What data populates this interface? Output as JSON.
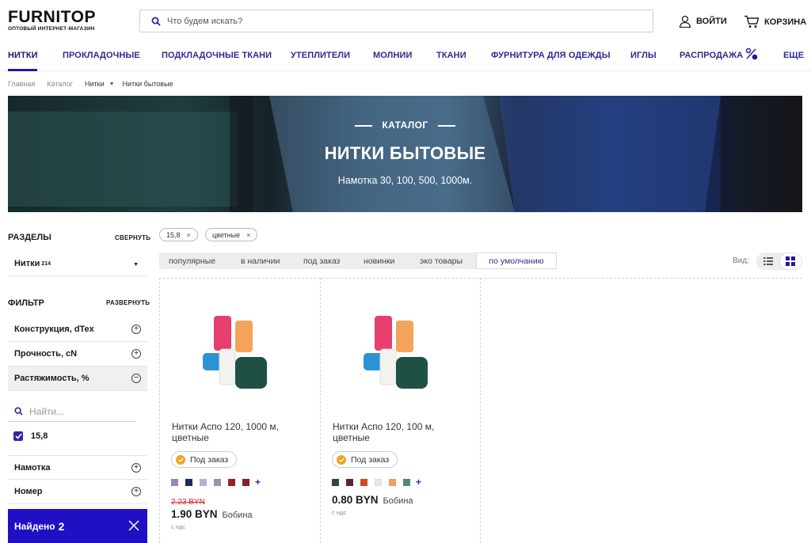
{
  "header": {
    "logo": "FURNITOP",
    "logo_sub": "ОПТОВЫЙ ИНТЕРНЕТ-МАГАЗИН",
    "search_placeholder": "Что будем искать?",
    "login": "ВОЙТИ",
    "cart": "КОРЗИНА"
  },
  "nav": {
    "items": [
      "НИТКИ",
      "ПРОКЛАДОЧНЫЕ",
      "ПОДКЛАДОЧНЫЕ ТКАНИ",
      "УТЕПЛИТЕЛИ",
      "МОЛНИИ",
      "ТКАНИ",
      "ФУРНИТУРА ДЛЯ ОДЕЖДЫ",
      "ИГЛЫ",
      "РАСПРОДАЖА",
      "ЕЩЕ"
    ],
    "active_index": 0,
    "accent": "#2217a6"
  },
  "breadcrumbs": [
    "Главная",
    "Каталог",
    "Нитки",
    "Нитки бытовые"
  ],
  "banner": {
    "kicker": "КАТАЛОГ",
    "title": "НИТКИ БЫТОВЫЕ",
    "subtitle": "Намотка 30, 100, 500, 1000м."
  },
  "sidebar": {
    "sections_title": "РАЗДЕЛЫ",
    "collapse": "СВЕРНУТЬ",
    "section_item": "Нитки",
    "section_count": "214",
    "filter_title": "ФИЛЬТР",
    "expand": "РАЗВЕРНУТЬ",
    "filters": [
      "Конструкция, dTex",
      "Прочность, cN",
      "Растяжимость, %"
    ],
    "find_placeholder": "Найти...",
    "checked_value": "15,8",
    "filters_more": [
      "Намотка",
      "Номер"
    ],
    "found_label": "Найдено",
    "found_count": "2"
  },
  "tags": [
    "15,8",
    "цветные"
  ],
  "sort": {
    "options": [
      "популярные",
      "в наличии",
      "под заказ",
      "новинки",
      "эко товары"
    ],
    "active": "по умолчанию",
    "view_label": "Вид:"
  },
  "products": [
    {
      "name": "Нитки Аспо 120, 1000 м, цветные",
      "badge": "Под заказ",
      "swatches": [
        "#9a86b8",
        "#1f2a5a",
        "#b7b0d0",
        "#9a8fb5",
        "#9c1d2b",
        "#8a1d2a"
      ],
      "old_price": "2.23 BYN",
      "price": "1.90 BYN",
      "unit": "Бобина",
      "vat": "с ндс"
    },
    {
      "name": "Нитки Аспо 120, 100 м, цветные",
      "badge": "Под заказ",
      "swatches": [
        "#3a3f4a",
        "#5a2630",
        "#d34a1a",
        "#f1e4de",
        "#f0a060",
        "#4a8a78"
      ],
      "old_price": "",
      "price": "0.80 BYN",
      "unit": "Бобина",
      "vat": "с ндс"
    }
  ]
}
